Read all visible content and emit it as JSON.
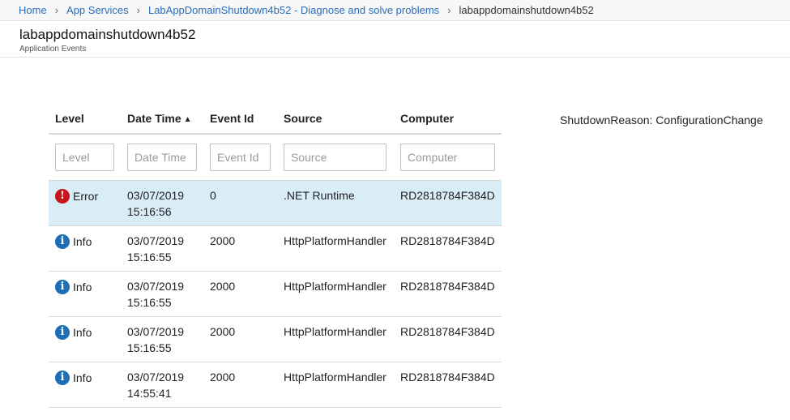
{
  "breadcrumb": {
    "items": [
      "Home",
      "App Services",
      "LabAppDomainShutdown4b52 - Diagnose and solve problems",
      "labappdomainshutdown4b52"
    ]
  },
  "header": {
    "title": "labappdomainshutdown4b52",
    "subtitle": "Application Events"
  },
  "table": {
    "columns": [
      "Level",
      "Date Time",
      "Event Id",
      "Source",
      "Computer"
    ],
    "sort_indicator": "▲",
    "filters": {
      "level_placeholder": "Level",
      "datetime_placeholder": "Date Time",
      "eventid_placeholder": "Event Id",
      "source_placeholder": "Source",
      "computer_placeholder": "Computer"
    },
    "rows": [
      {
        "level": "Error",
        "date": "03/07/2019",
        "time": "15:16:56",
        "event_id": "0",
        "source": ".NET Runtime",
        "computer": "RD2818784F384D"
      },
      {
        "level": "Info",
        "date": "03/07/2019",
        "time": "15:16:55",
        "event_id": "2000",
        "source": "HttpPlatformHandler",
        "computer": "RD2818784F384D"
      },
      {
        "level": "Info",
        "date": "03/07/2019",
        "time": "15:16:55",
        "event_id": "2000",
        "source": "HttpPlatformHandler",
        "computer": "RD2818784F384D"
      },
      {
        "level": "Info",
        "date": "03/07/2019",
        "time": "15:16:55",
        "event_id": "2000",
        "source": "HttpPlatformHandler",
        "computer": "RD2818784F384D"
      },
      {
        "level": "Info",
        "date": "03/07/2019",
        "time": "14:55:41",
        "event_id": "2000",
        "source": "HttpPlatformHandler",
        "computer": "RD2818784F384D"
      }
    ]
  },
  "detail": {
    "shutdown_reason": "ShutdownReason: ConfigurationChange"
  },
  "icons": {
    "error_icon": "!",
    "info_icon": "i",
    "breadcrumb_separator": "›"
  },
  "colors": {
    "error": "#c4161c",
    "info": "#1c6fb5",
    "selected_row": "#d9edf7",
    "link": "#2a6ebb"
  }
}
